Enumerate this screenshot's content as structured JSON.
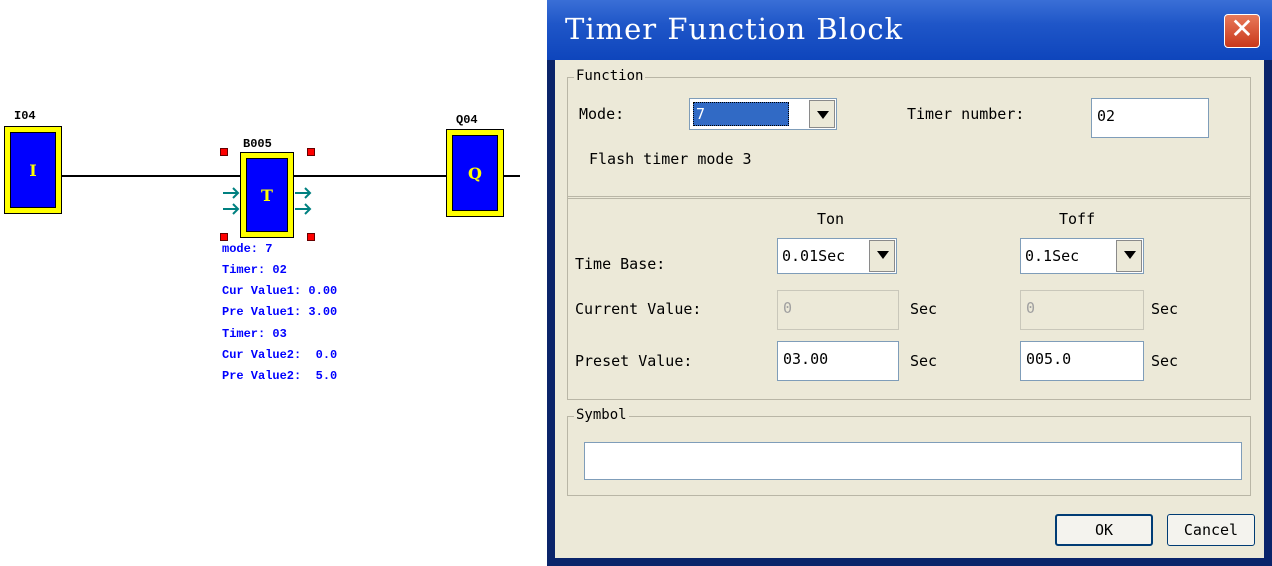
{
  "diagram": {
    "input_block": {
      "tag": "I04",
      "letter": "I"
    },
    "timer_block": {
      "tag": "B005",
      "letter": "T"
    },
    "output_block": {
      "tag": "Q04",
      "letter": "Q"
    },
    "info_lines": [
      "mode: 7",
      "Timer: 02",
      "Cur Value1: 0.00",
      "Pre Value1: 3.00",
      "Timer: 03",
      "Cur Value2:  0.0",
      "Pre Value2:  5.0"
    ]
  },
  "dialog": {
    "title": "Timer Function Block",
    "function_group": {
      "legend": "Function",
      "mode_label": "Mode:",
      "mode_value": "7",
      "timer_number_label": "Timer number:",
      "timer_number_value": "02",
      "description": "Flash timer mode 3"
    },
    "timing_group": {
      "ton_header": "Ton",
      "toff_header": "Toff",
      "time_base_label": "Time Base:",
      "current_value_label": "Current Value:",
      "preset_value_label": "Preset Value:",
      "ton_time_base": "0.01Sec",
      "toff_time_base": "0.1Sec",
      "ton_current_value": "0",
      "toff_current_value": "0",
      "ton_preset_value": "03.00",
      "toff_preset_value": "005.0",
      "unit": "Sec"
    },
    "symbol_group": {
      "legend": "Symbol",
      "value": ""
    },
    "buttons": {
      "ok": "OK",
      "cancel": "Cancel"
    }
  }
}
